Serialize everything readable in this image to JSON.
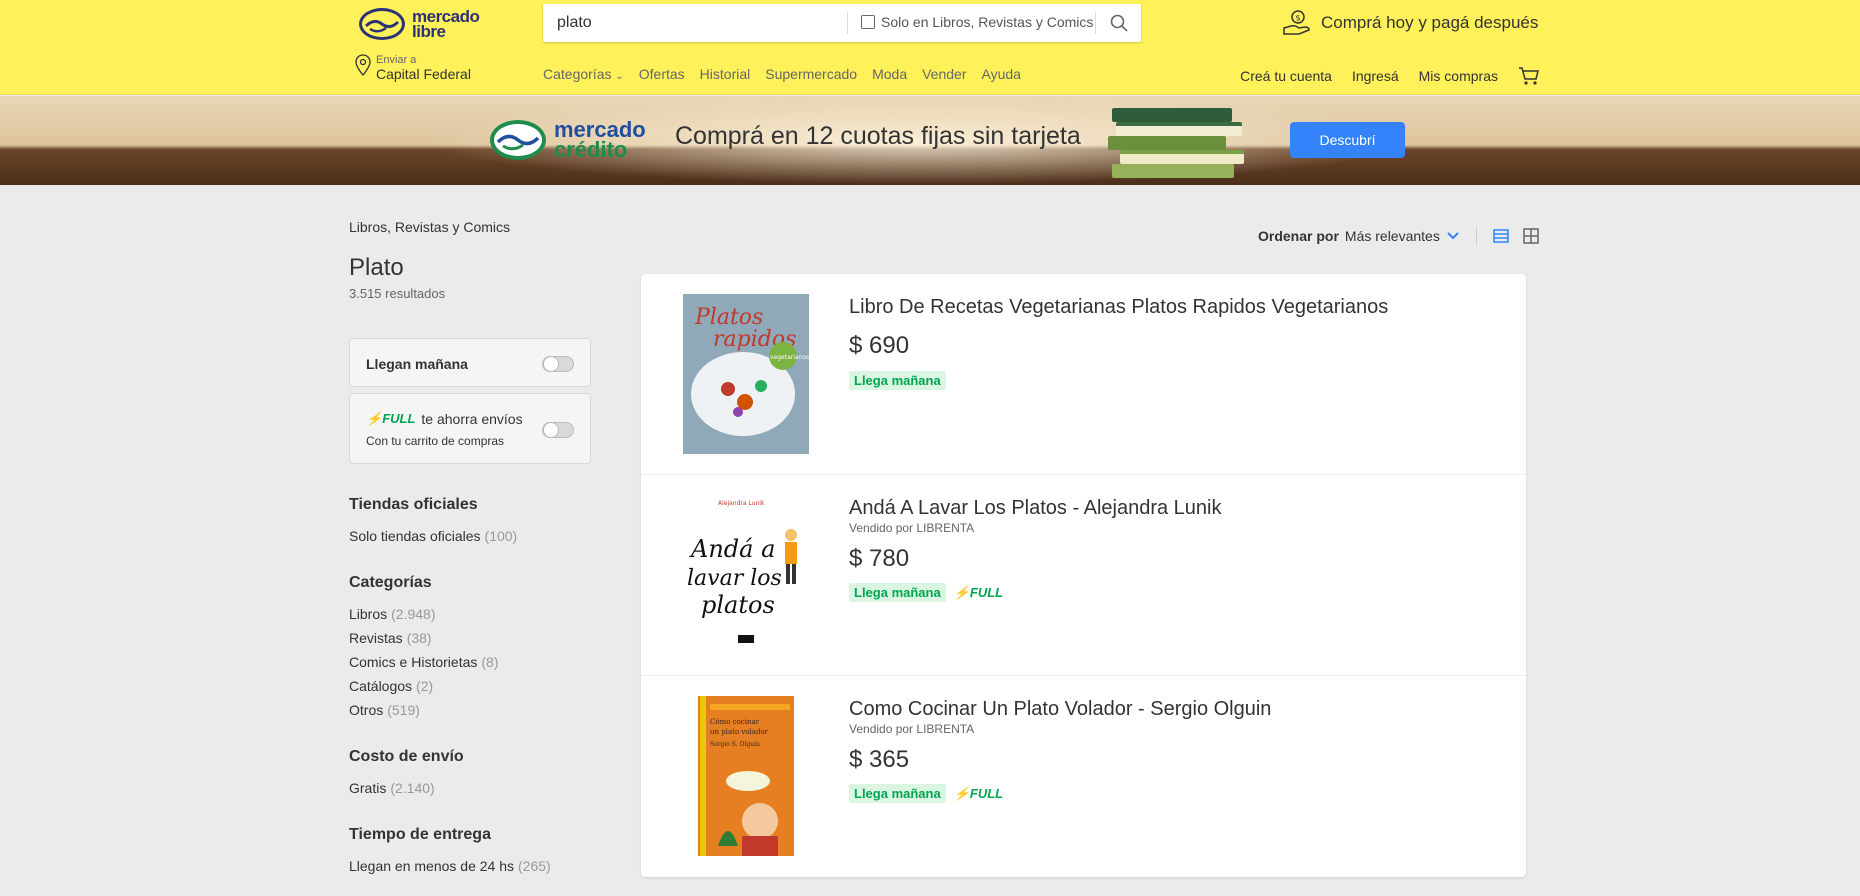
{
  "header": {
    "logo_line1": "mercado",
    "logo_line2": "libre",
    "search_value": "plato",
    "search_filter_label": "Solo en Libros, Revistas y Comics",
    "promo_text": "Comprá hoy y pagá después",
    "location_small": "Enviar a",
    "location_big": "Capital Federal",
    "nav": [
      "Categorías",
      "Ofertas",
      "Historial",
      "Supermercado",
      "Moda",
      "Vender",
      "Ayuda"
    ],
    "account": [
      "Creá tu cuenta",
      "Ingresá",
      "Mis compras"
    ]
  },
  "banner": {
    "brand_line1": "mercado",
    "brand_line2": "crédito",
    "title": "Comprá en 12 cuotas fijas sin tarjeta",
    "button": "Descubrí"
  },
  "sidebar": {
    "breadcrumb": "Libros, Revistas y Comics",
    "title": "Plato",
    "results": "3.515 resultados",
    "toggle1_label": "Llegan mañana",
    "full_badge": "FULL",
    "toggle2_label": "te ahorra envíos",
    "toggle2_sub": "Con tu carrito de compras",
    "sections": [
      {
        "title": "Tiendas oficiales",
        "items": [
          {
            "label": "Solo tiendas oficiales",
            "count": "(100)"
          }
        ]
      },
      {
        "title": "Categorías",
        "items": [
          {
            "label": "Libros",
            "count": "(2.948)"
          },
          {
            "label": "Revistas",
            "count": "(38)"
          },
          {
            "label": "Comics e Historietas",
            "count": "(8)"
          },
          {
            "label": "Catálogos",
            "count": "(2)"
          },
          {
            "label": "Otros",
            "count": "(519)"
          }
        ]
      },
      {
        "title": "Costo de envío",
        "items": [
          {
            "label": "Gratis",
            "count": "(2.140)"
          }
        ]
      },
      {
        "title": "Tiempo de entrega",
        "items": [
          {
            "label": "Llegan en menos de 24 hs",
            "count": "(265)"
          }
        ]
      }
    ]
  },
  "sort": {
    "label": "Ordenar por",
    "value": "Más relevantes"
  },
  "results": [
    {
      "title": "Libro De Recetas Vegetarianas Platos Rapidos Vegetarianos",
      "seller": "",
      "price": "$ 690",
      "ship": "Llega mañana",
      "full": ""
    },
    {
      "title": "Andá A Lavar Los Platos - Alejandra Lunik",
      "seller": "Vendido por LIBRENTA",
      "price": "$ 780",
      "ship": "Llega mañana",
      "full": "FULL"
    },
    {
      "title": "Como Cocinar Un Plato Volador - Sergio Olguin",
      "seller": "Vendido por LIBRENTA",
      "price": "$ 365",
      "ship": "Llega mañana",
      "full": "FULL"
    }
  ],
  "covers": {
    "c1_line1": "Platos",
    "c1_line2": "rapidos",
    "c1_badge": "vegetarianos",
    "c2_author": "Alejandra Lunik",
    "c2_l1": "Andá a",
    "c2_l2": "lavar los",
    "c2_l3": "platos",
    "c3_l1": "Cómo cocinar",
    "c3_l2": "un plato volador",
    "c3_l3": "Sergio S. Olguín"
  }
}
